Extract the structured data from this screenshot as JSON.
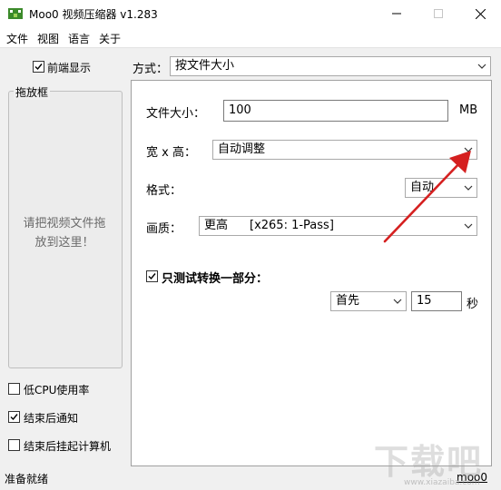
{
  "window": {
    "title": "Moo0 视频压缩器 v1.283"
  },
  "menu": {
    "file": "文件",
    "view": "视图",
    "language": "语言",
    "about": "关于"
  },
  "left": {
    "always_on_top": {
      "label": "前端显示",
      "checked": true
    },
    "drop_zone": {
      "title": "拖放框",
      "hint": "请把视频文件拖放到这里！"
    },
    "low_cpu": {
      "label": "低CPU使用率",
      "checked": false
    },
    "notify_after": {
      "label": "结束后通知",
      "checked": true
    },
    "hibernate_after": {
      "label": "结束后挂起计算机",
      "checked": false
    }
  },
  "mode": {
    "label": "方式：",
    "value": "按文件大小"
  },
  "settings": {
    "file_size": {
      "label": "文件大小：",
      "value": "100",
      "unit": "MB"
    },
    "dimensions": {
      "label": "宽 x 高：",
      "value": "自动调整"
    },
    "format": {
      "label": "格式：",
      "value": "自动"
    },
    "quality": {
      "label": "画质：",
      "value": "更高",
      "codec": "[x265: 1-Pass]"
    },
    "test_part": {
      "label": "只测试转换一部分：",
      "checked": true,
      "position": "首先",
      "seconds": "15",
      "seconds_unit": "秒"
    }
  },
  "status": {
    "text": "准备就绪",
    "brand": "moo0"
  },
  "watermark": {
    "text": "下载吧",
    "url": "www.xiazaiba.com"
  },
  "colors": {
    "arrow": "#d52020",
    "icon_green": "#3b8a2a"
  }
}
